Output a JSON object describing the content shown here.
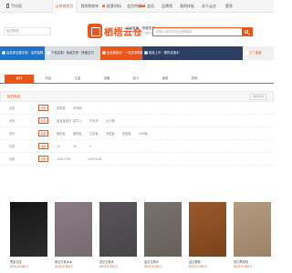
{
  "topnav": {
    "mobile_label": "手机版",
    "items": [
      {
        "label": "云商城首页",
        "active": true,
        "badge": ""
      },
      {
        "label": "我的购物车",
        "active": false,
        "badge": "0"
      },
      {
        "label": "配套材料",
        "active": false,
        "badge": ""
      },
      {
        "label": "会员特权",
        "active": false,
        "badge": "HOT"
      },
      {
        "label": "会员",
        "active": false,
        "badge": ""
      },
      {
        "label": "品牌馆",
        "active": false,
        "badge": ""
      },
      {
        "label": "我的样板",
        "active": false,
        "badge": ""
      },
      {
        "label": "关于云仓",
        "active": false,
        "badge": ""
      },
      {
        "label": "更多",
        "active": false,
        "badge": ""
      }
    ]
  },
  "header": {
    "left_select": "板材商城",
    "logo_text": "栖梧云仓",
    "slogan": "正品直供 · 快速发货",
    "slogan_sub": "全屋定制板材一站式采购",
    "search_placeholder": "请输入板材/花色/品牌搜索"
  },
  "banners": [
    {
      "text": "高品质全屋定制 · 品质保障 · 源头工厂",
      "bg": "#1e73c8",
      "color": "#ffffff"
    },
    {
      "text": "个性定制 · 免费打样 · 快速交付",
      "bg": "#d8dde3",
      "color": "#333333"
    },
    {
      "text": "全品类板材 · 一站式采购服务",
      "bg": "#e8561c",
      "color": "#ffffff"
    },
    {
      "text": "新品上市 · 限时优惠中",
      "bg": "#2c3e63",
      "color": "#ffffff"
    },
    {
      "text": "工厂直营",
      "bg": "#f0f0f0",
      "color": "#e8561c"
    }
  ],
  "categories": [
    {
      "label": "板材",
      "active": true
    },
    {
      "label": "封边",
      "active": false
    },
    {
      "label": "五金",
      "active": false
    },
    {
      "label": "设备",
      "active": false
    },
    {
      "label": "色卡",
      "active": false
    },
    {
      "label": "画册",
      "active": false
    },
    {
      "label": "其他",
      "active": false
    }
  ],
  "panel": {
    "title": "板材商品",
    "more_label": "收起筛选",
    "rows": [
      {
        "label": "品类",
        "all": "全部",
        "options": [
          "多层板",
          "木饰面"
        ]
      },
      {
        "label": "品牌",
        "all": "全部",
        "options": [
          "兔宝宝板材",
          "莫干山",
          "千年舟",
          "大王椰"
        ]
      },
      {
        "label": "基材",
        "all": "全部",
        "options": [
          "颗粒板",
          "欧松板",
          "生态板",
          "多层板",
          "密度板",
          "OSB板"
        ]
      },
      {
        "label": "厚度",
        "all": "全部",
        "options": [
          "18",
          "25",
          "9"
        ]
      },
      {
        "label": "规格",
        "all": "全部",
        "options": [
          "1220*2750",
          "1220*2440"
        ]
      }
    ]
  },
  "products": [
    {
      "name": "黑金石纹",
      "price": "¥103.0+536.0",
      "img_top": "#161616",
      "img_bottom": "#2d2d2d"
    },
    {
      "name": "雨丝卡其★★",
      "price": "¥103.0+365.0",
      "img_top": "#8a7c82",
      "img_bottom": "#766a70"
    },
    {
      "name": "金丝玉檀木",
      "price": "¥103.0+365.0",
      "img_top": "#585659",
      "img_bottom": "#474548"
    },
    {
      "name": "金丝玉檀木",
      "price": "¥103.0+365.0",
      "img_top": "#78726c",
      "img_bottom": "#65605a"
    },
    {
      "name": "金丝樱桃",
      "price": "¥103.0+365.0",
      "img_top": "#9a5a2a",
      "img_bottom": "#7a431c"
    },
    {
      "name": "进口黑胡桃",
      "price": "¥103.0+365.0",
      "img_top": "#b39a80",
      "img_bottom": "#9c8368"
    }
  ]
}
